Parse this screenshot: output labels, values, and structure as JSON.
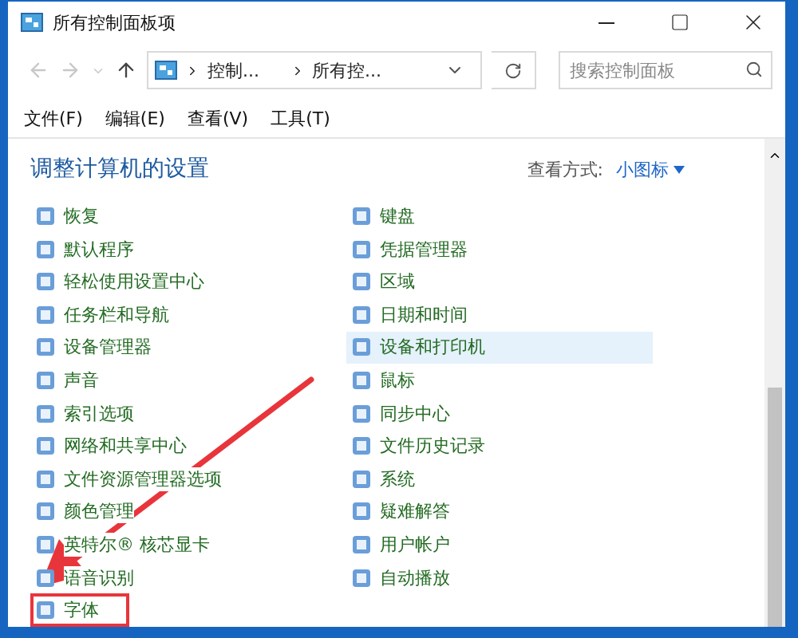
{
  "window": {
    "title": "所有控制面板项"
  },
  "navigation": {
    "breadcrumbs": [
      "控制...",
      "所有控..."
    ],
    "search": {
      "placeholder": "搜索控制面板"
    }
  },
  "menu": [
    "文件(F)",
    "编辑(E)",
    "查看(V)",
    "工具(T)"
  ],
  "header": {
    "title": "调整计算机的设置",
    "view_label": "查看方式:",
    "view_value": "小图标"
  },
  "columns": [
    [
      {
        "label": "恢复",
        "highlighted": false,
        "marked": false
      },
      {
        "label": "默认程序",
        "highlighted": false,
        "marked": false
      },
      {
        "label": "轻松使用设置中心",
        "highlighted": false,
        "marked": false
      },
      {
        "label": "任务栏和导航",
        "highlighted": false,
        "marked": false
      },
      {
        "label": "设备管理器",
        "highlighted": false,
        "marked": false
      },
      {
        "label": "声音",
        "highlighted": false,
        "marked": false
      },
      {
        "label": "索引选项",
        "highlighted": false,
        "marked": false
      },
      {
        "label": "网络和共享中心",
        "highlighted": false,
        "marked": false
      },
      {
        "label": "文件资源管理器选项",
        "highlighted": false,
        "marked": false
      },
      {
        "label": "颜色管理",
        "highlighted": false,
        "marked": false
      },
      {
        "label": "英特尔® 核芯显卡",
        "highlighted": false,
        "marked": false
      },
      {
        "label": "语音识别",
        "highlighted": false,
        "marked": false
      },
      {
        "label": "字体",
        "highlighted": false,
        "marked": true
      }
    ],
    [
      {
        "label": "键盘",
        "highlighted": false,
        "marked": false
      },
      {
        "label": "凭据管理器",
        "highlighted": false,
        "marked": false
      },
      {
        "label": "区域",
        "highlighted": false,
        "marked": false
      },
      {
        "label": "日期和时间",
        "highlighted": false,
        "marked": false
      },
      {
        "label": "设备和打印机",
        "highlighted": true,
        "marked": false
      },
      {
        "label": "鼠标",
        "highlighted": false,
        "marked": false
      },
      {
        "label": "同步中心",
        "highlighted": false,
        "marked": false
      },
      {
        "label": "文件历史记录",
        "highlighted": false,
        "marked": false
      },
      {
        "label": "系统",
        "highlighted": false,
        "marked": false
      },
      {
        "label": "疑难解答",
        "highlighted": false,
        "marked": false
      },
      {
        "label": "用户帐户",
        "highlighted": false,
        "marked": false
      },
      {
        "label": "自动播放",
        "highlighted": false,
        "marked": false
      }
    ]
  ]
}
